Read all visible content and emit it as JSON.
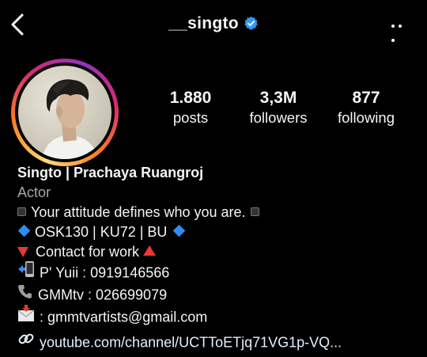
{
  "header": {
    "username": "__singto",
    "back_icon": "chevron-left-icon",
    "verified_icon": "verified-badge-icon",
    "more_icon": "more-horizontal-icon",
    "verified_color": "#3897f0"
  },
  "stats": [
    {
      "value": "1.880",
      "label": "posts"
    },
    {
      "value": "3,3M",
      "label": "followers"
    },
    {
      "value": "877",
      "label": "following"
    }
  ],
  "bio": {
    "full_name": "Singto | Prachaya Ruangroj",
    "category": "Actor",
    "lines": [
      "Your attitude defines who you are.",
      "OSK130 | KU72 | BU",
      "Contact for work",
      "P' Yuii : 0919146566",
      "GMMtv : 026699079",
      ": gmmtvartists@gmail.com"
    ],
    "link": "youtube.com/channel/UCTToETjq71VG1p-VQ...",
    "link_icon": "link-icon"
  },
  "colors": {
    "background": "#000000",
    "category_text": "#a8a8a8",
    "link_text": "#e0f1ff"
  }
}
